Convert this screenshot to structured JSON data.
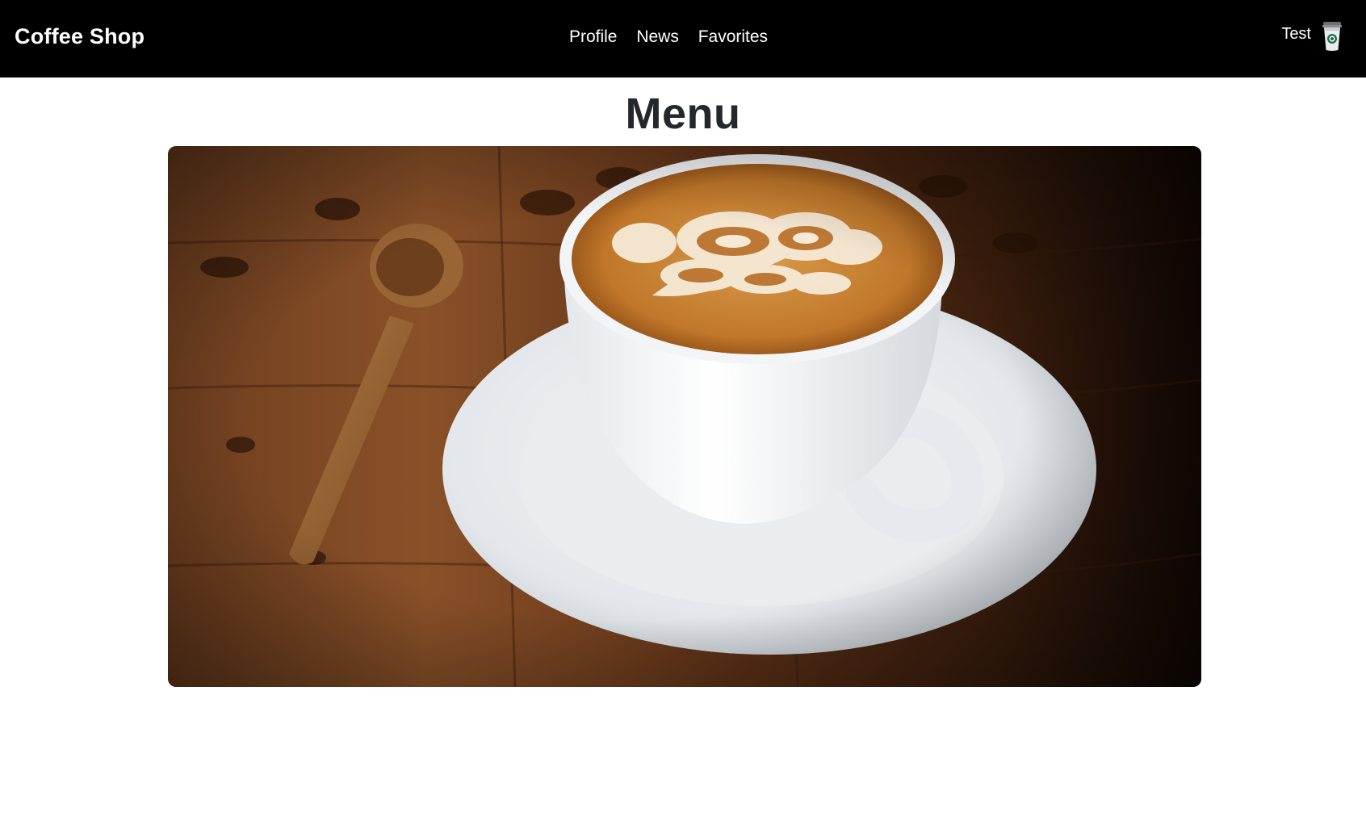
{
  "navbar": {
    "brand": "Coffee Shop",
    "links": [
      {
        "label": "Profile"
      },
      {
        "label": "News"
      },
      {
        "label": "Favorites"
      }
    ],
    "user": {
      "name": "Test",
      "icon": "coffee-cup-icon"
    }
  },
  "main": {
    "title": "Menu",
    "hero_image": {
      "subject": "latte-art-coffee-cup-icon"
    }
  },
  "colors": {
    "navbar_bg": "#000000",
    "navbar_text": "#ffffff",
    "title_text": "#24282d",
    "page_bg": "#ffffff"
  }
}
